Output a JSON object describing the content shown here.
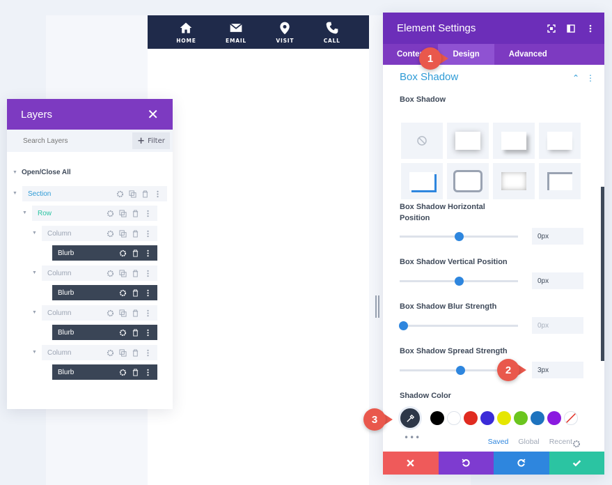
{
  "topnav": {
    "items": [
      {
        "label": "HOME",
        "icon": "home-icon"
      },
      {
        "label": "EMAIL",
        "icon": "email-icon"
      },
      {
        "label": "VISIT",
        "icon": "map-pin-icon"
      },
      {
        "label": "CALL",
        "icon": "phone-icon"
      }
    ]
  },
  "layers": {
    "title": "Layers",
    "search_placeholder": "Search Layers",
    "filter_label": "Filter",
    "open_close_all": "Open/Close All",
    "section_label": "Section",
    "row_label": "Row",
    "columns": [
      {
        "label": "Column",
        "module": "Blurb"
      },
      {
        "label": "Column",
        "module": "Blurb"
      },
      {
        "label": "Column",
        "module": "Blurb"
      },
      {
        "label": "Column",
        "module": "Blurb"
      }
    ]
  },
  "settings": {
    "title": "Element Settings",
    "tabs": [
      "Content",
      "Design",
      "Advanced"
    ],
    "active_tab": "Design",
    "section_title": "Box Shadow",
    "box_shadow_label": "Box Shadow",
    "horizontal": {
      "label": "Box Shadow Horizontal Position",
      "value": "0px",
      "position": 0.5
    },
    "vertical": {
      "label": "Box Shadow Vertical Position",
      "value": "0px",
      "position": 0.5
    },
    "blur": {
      "label": "Box Shadow Blur Strength",
      "value": "0px",
      "position": 0.03
    },
    "spread": {
      "label": "Box Shadow Spread Strength",
      "value": "3px",
      "position": 0.51
    },
    "shadow_color_label": "Shadow Color",
    "swatches": [
      "#000000",
      "#ffffff",
      "#e02b20",
      "#3b2bd8",
      "#e6e600",
      "#6bc51e",
      "#1e73be",
      "#8a1ae0"
    ],
    "palette_tabs": [
      "Saved",
      "Global",
      "Recent"
    ],
    "more_dots": "•••"
  },
  "callouts": [
    "1",
    "2",
    "3"
  ],
  "colors": {
    "purple_dark": "#6c2eb9",
    "purple": "#7d3ac1",
    "blue_accent": "#2e86de",
    "footer_red": "#ef5a5a",
    "footer_purple": "#7e3bd0",
    "footer_blue": "#2e86de",
    "footer_green": "#2bc4a2",
    "callout_red": "#e9584c"
  }
}
